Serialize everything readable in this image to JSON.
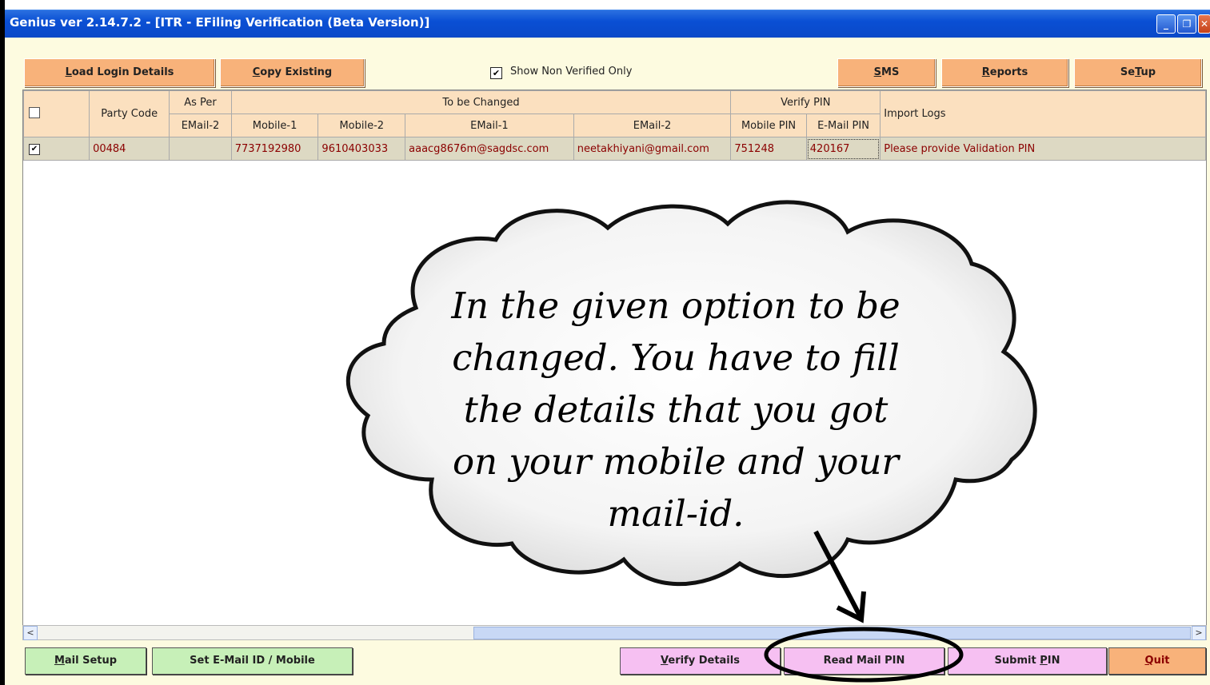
{
  "window": {
    "title": "Genius ver 2.14.7.2 - [ITR - EFiling Verification (Beta Version)]",
    "minimize_glyph": "_",
    "restore_glyph": "❐",
    "close_glyph": "✕"
  },
  "toolbar": {
    "load_login": {
      "hot": "L",
      "rest": "oad Login Details"
    },
    "copy_existing": {
      "hot": "C",
      "rest": "opy Existing"
    },
    "show_non_verified": "Show Non Verified Only",
    "show_non_verified_checked": "✔",
    "sms": {
      "hot": "S",
      "rest": "MS"
    },
    "reports": {
      "hot": "R",
      "rest": "eports"
    },
    "setup": {
      "pre": "Se",
      "hot": "T",
      "rest": "up"
    }
  },
  "table": {
    "headers": {
      "party_code": "Party Code",
      "as_per": "As Per",
      "to_be_changed": "To be Changed",
      "verify_pin": "Verify PIN",
      "import_logs": "Import Logs",
      "email2_a": "EMail-2",
      "mobile1": "Mobile-1",
      "mobile2": "Mobile-2",
      "email1": "EMail-1",
      "email2_b": "EMail-2",
      "mobile_pin": "Mobile PIN",
      "email_pin": "E-Mail PIN"
    },
    "rows": [
      {
        "checked": "✔",
        "party_code": "00484",
        "as_per_email2": "",
        "mobile1": "7737192980",
        "mobile2": "9610403033",
        "email1": "aaacg8676m@sagdsc.com",
        "email2": "neetakhiyani@gmail.com",
        "mobile_pin": "751248",
        "email_pin": "420167",
        "import_log": "Please provide Validation PIN"
      }
    ]
  },
  "scrollbar": {
    "left": "<",
    "right": ">"
  },
  "bottom": {
    "mail_setup": {
      "hot": "M",
      "rest": "ail Setup"
    },
    "set_email": "Set E-Mail ID / Mobile",
    "verify_details": {
      "hot": "V",
      "rest": "erify Details"
    },
    "read_mail_pin": "Read Mail PIN",
    "submit_pin": {
      "pre": "Submit ",
      "hot": "P",
      "rest": "IN"
    },
    "quit": {
      "hot": "Q",
      "rest": "uit"
    }
  },
  "callout": {
    "lines": [
      "In the given option to be",
      "changed. You have to fill",
      "the details that you got",
      "on your mobile and your",
      "mail-id."
    ]
  }
}
